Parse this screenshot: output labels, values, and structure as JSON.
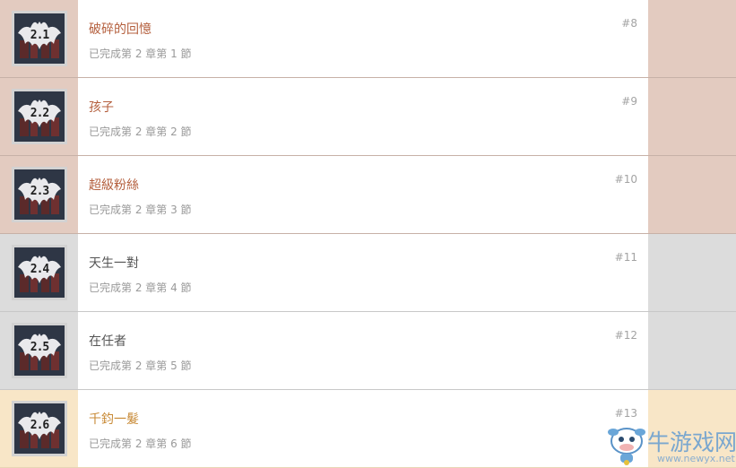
{
  "colors": {
    "complete_accent": "#e3cbc0",
    "neutral_accent": "#dcdcdc",
    "gold_accent": "#f8e6c7",
    "complete_title": "#b45f3d",
    "neutral_title": "#555555",
    "gold_title": "#c88a36"
  },
  "achievements": [
    {
      "badge": "2.1",
      "title": "破碎的回憶",
      "status": "已完成第 2 章第 1 節",
      "number": "#8",
      "tier": "complete"
    },
    {
      "badge": "2.2",
      "title": "孩子",
      "status": "已完成第 2 章第 2 節",
      "number": "#9",
      "tier": "complete"
    },
    {
      "badge": "2.3",
      "title": "超級粉絲",
      "status": "已完成第 2 章第 3 節",
      "number": "#10",
      "tier": "complete"
    },
    {
      "badge": "2.4",
      "title": "天生一對",
      "status": "已完成第 2 章第 4 節",
      "number": "#11",
      "tier": "neutral"
    },
    {
      "badge": "2.5",
      "title": "在任者",
      "status": "已完成第 2 章第 5 節",
      "number": "#12",
      "tier": "neutral"
    },
    {
      "badge": "2.6",
      "title": "千鈞一髮",
      "status": "已完成第 2 章第 6 節",
      "number": "#13",
      "tier": "gold"
    }
  ],
  "watermark": {
    "text": "牛游戏网",
    "url": "www.newyx.net",
    "icon": "cartoon-cow-mascot-icon"
  }
}
